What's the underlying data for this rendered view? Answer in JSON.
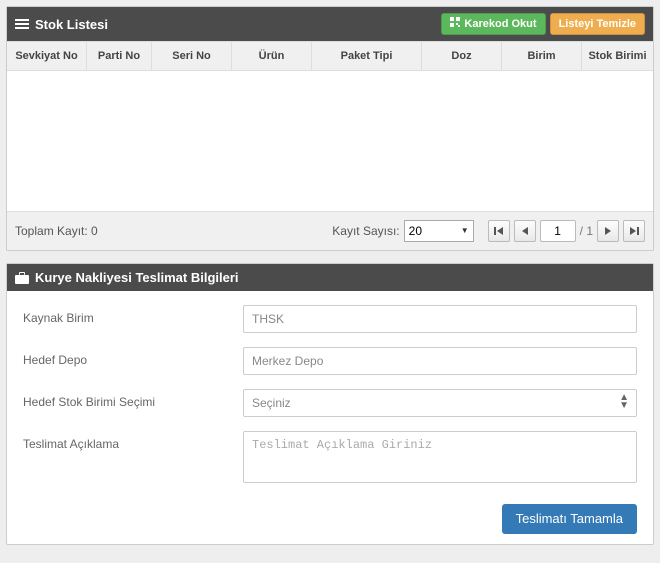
{
  "stock_panel": {
    "title": "Stok Listesi",
    "btn_scan": "Karekod Okut",
    "btn_clear": "Listeyi Temizle",
    "columns": {
      "sevkiyat": "Sevkiyat No",
      "parti": "Parti No",
      "seri": "Seri No",
      "urun": "Ürün",
      "paket": "Paket Tipi",
      "doz": "Doz",
      "birim": "Birim",
      "stok": "Stok Birimi"
    },
    "footer": {
      "total_label": "Toplam Kayıt:",
      "total_value": "0",
      "page_size_label": "Kayıt Sayısı:",
      "page_size_value": "20",
      "current_page": "1",
      "total_pages": "1"
    }
  },
  "delivery_panel": {
    "title": "Kurye Nakliyesi Teslimat Bilgileri",
    "labels": {
      "kaynak": "Kaynak Birim",
      "hedef_depo": "Hedef Depo",
      "hedef_stok": "Hedef Stok Birimi Seçimi",
      "aciklama": "Teslimat Açıklama"
    },
    "values": {
      "kaynak": "THSK",
      "hedef_depo": "Merkez Depo",
      "hedef_stok": "Seçiniz"
    },
    "placeholders": {
      "aciklama": "Teslimat Açıklama Giriniz"
    },
    "btn_submit": "Teslimatı Tamamla"
  }
}
